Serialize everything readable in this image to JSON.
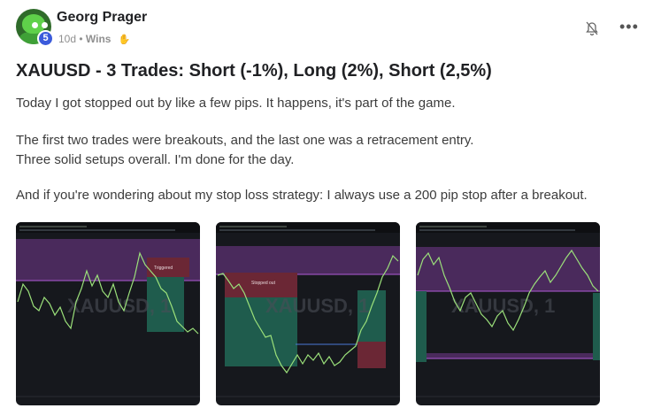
{
  "post": {
    "author": "Georg Prager",
    "level": "5",
    "time": "10d",
    "category": "Wins",
    "title": "XAUUSD - 3 Trades: Short (-1%), Long (2%), Short (2,5%)",
    "paragraph_1": "Today I got stopped out by like a few pips. It happens, it's part of the game.",
    "paragraph_2_line_1": "The first two trades were breakouts, and the last one was a retracement entry.",
    "paragraph_2_line_2": "Three solid setups overall. I'm done for the day.",
    "paragraph_3": "And if you're wondering about my stop loss strategy: I always use a 200 pip stop after a breakout."
  },
  "icons": {
    "bell": "bell-off-icon",
    "more": "more-horizontal-icon",
    "clap": "clap-icon"
  },
  "charts": [
    {
      "watermark": "XAUUSD, 1",
      "box_label": "Triggered"
    },
    {
      "watermark": "XAUUSD, 1",
      "box_label": "Stopped out"
    },
    {
      "watermark": "XAUUSD, 1",
      "box_label": ""
    }
  ],
  "colors": {
    "zone_purple": "#4a2a5c",
    "zone_green": "#1f5c4d",
    "zone_red": "#6b2735",
    "candle_green": "#9be07a"
  }
}
